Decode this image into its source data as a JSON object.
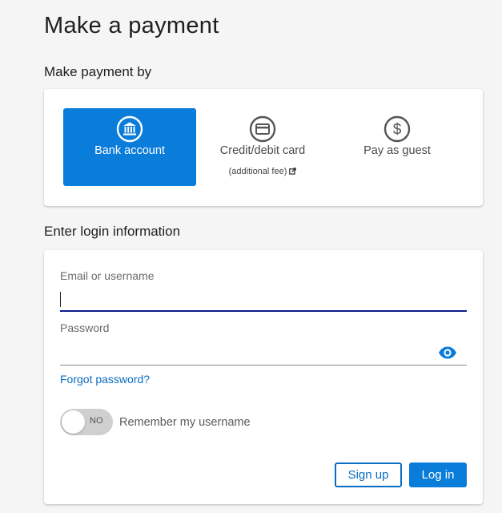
{
  "page": {
    "title": "Make a payment"
  },
  "payment_method": {
    "heading": "Make payment by",
    "options": [
      {
        "label": "Bank account",
        "icon": "bank-icon",
        "selected": true
      },
      {
        "label": "Credit/debit card",
        "sublabel": "(additional fee)",
        "icon": "credit-card-icon",
        "selected": false
      },
      {
        "label": "Pay as guest",
        "icon": "dollar-icon",
        "selected": false
      }
    ]
  },
  "login": {
    "heading": "Enter login information",
    "email_label": "Email or username",
    "email_value": "",
    "password_label": "Password",
    "password_value": "",
    "forgot_link": "Forgot password?",
    "toggle_state": "NO",
    "remember_label": "Remember my username",
    "signup_label": "Sign up",
    "login_label": "Log in"
  },
  "colors": {
    "accent": "#0a7cd9",
    "link": "#0a6dc2",
    "focus_underline": "#0b1c8c",
    "background": "#f5f5f5"
  }
}
